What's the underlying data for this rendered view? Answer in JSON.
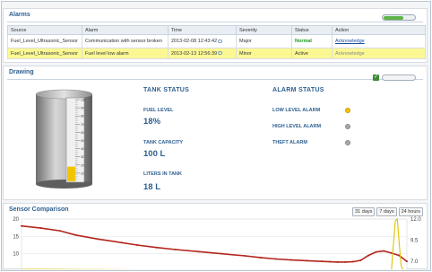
{
  "alarms": {
    "title": "Alarms",
    "columns": [
      "Source",
      "Alarm",
      "Time",
      "Severity",
      "Status",
      "Action"
    ],
    "rows": [
      {
        "source": "Fuel_Level_Ultrasonic_Sensor",
        "alarm": "Communication with sensor broken",
        "time": "2013-02-08 12:43:42",
        "severity": "Major",
        "status": "Normal",
        "action": "Acknowledge"
      },
      {
        "source": "Fuel_Level_Ultrasonic_Sensor",
        "alarm": "Fuel level low alarm",
        "time": "2013-02-13 12:56:39",
        "severity": "Minor",
        "status": "Active",
        "action": "Acknowledge"
      }
    ]
  },
  "drawing": {
    "title": "Drawing",
    "tank_gauge_ticks": [
      "100",
      "90",
      "80",
      "70",
      "60",
      "50",
      "40",
      "30",
      "20",
      "10"
    ],
    "tank_fill_fraction": 0.18,
    "tank_status": {
      "heading": "TANK STATUS",
      "fuel_level_label": "FUEL LEVEL",
      "fuel_level_value": "18%",
      "capacity_label": "TANK CAPACITY",
      "capacity_value": "100 L",
      "liters_label": "LITERS IN TANK",
      "liters_value": "18 L"
    },
    "alarm_status": {
      "heading": "ALARM STATUS",
      "items": [
        {
          "label": "LOW LEVEL ALARM",
          "state": "active"
        },
        {
          "label": "HIGH LEVEL ALARM",
          "state": "inactive"
        },
        {
          "label": "THEFT ALARM",
          "state": "inactive"
        }
      ]
    }
  },
  "sensor": {
    "title": "Sensor Comparison",
    "ranges": [
      "31 days",
      "7 days",
      "24 hours"
    ]
  },
  "chart_data": {
    "type": "line",
    "title": "",
    "y_left_ticks": [
      "20",
      "15",
      "10"
    ],
    "y_right_ticks": [
      "12.0",
      "9.5",
      "7.0"
    ],
    "ylim_left": [
      5,
      20
    ],
    "ylim_right": [
      5.8,
      12.0
    ],
    "series": [
      {
        "color": "#b3261e",
        "x": [
          0,
          0.05,
          0.1,
          0.14,
          0.2,
          0.26,
          0.3,
          0.35,
          0.4,
          0.46,
          0.52,
          0.58,
          0.62,
          0.66,
          0.7,
          0.74,
          0.78,
          0.8,
          0.82,
          0.84,
          0.86,
          0.88,
          0.9,
          0.92,
          0.94,
          0.96,
          0.98,
          1.0
        ],
        "values": [
          18.0,
          17.4,
          16.6,
          15.4,
          14.2,
          13.2,
          12.5,
          11.8,
          11.2,
          10.6,
          10.0,
          9.4,
          8.9,
          8.5,
          8.2,
          8.0,
          7.8,
          7.7,
          7.6,
          7.6,
          7.7,
          8.1,
          9.5,
          10.5,
          10.8,
          10.2,
          9.5,
          7.8
        ]
      },
      {
        "color": "#e0c200",
        "x": [
          0,
          0.04,
          0.3,
          0.6,
          0.9,
          0.96,
          0.965,
          0.97,
          0.975,
          0.98,
          0.985,
          0.99
        ],
        "values": [
          5.5,
          5.5,
          5.4,
          5.4,
          5.4,
          5.4,
          12.5,
          19.5,
          20.0,
          13.0,
          6.5,
          5.5
        ]
      }
    ]
  },
  "colors": {
    "accent": "#2d5f8f",
    "highlight_row": "#fbf894",
    "normal": "#1a9a1a",
    "alarm_on": "#f2c400"
  }
}
